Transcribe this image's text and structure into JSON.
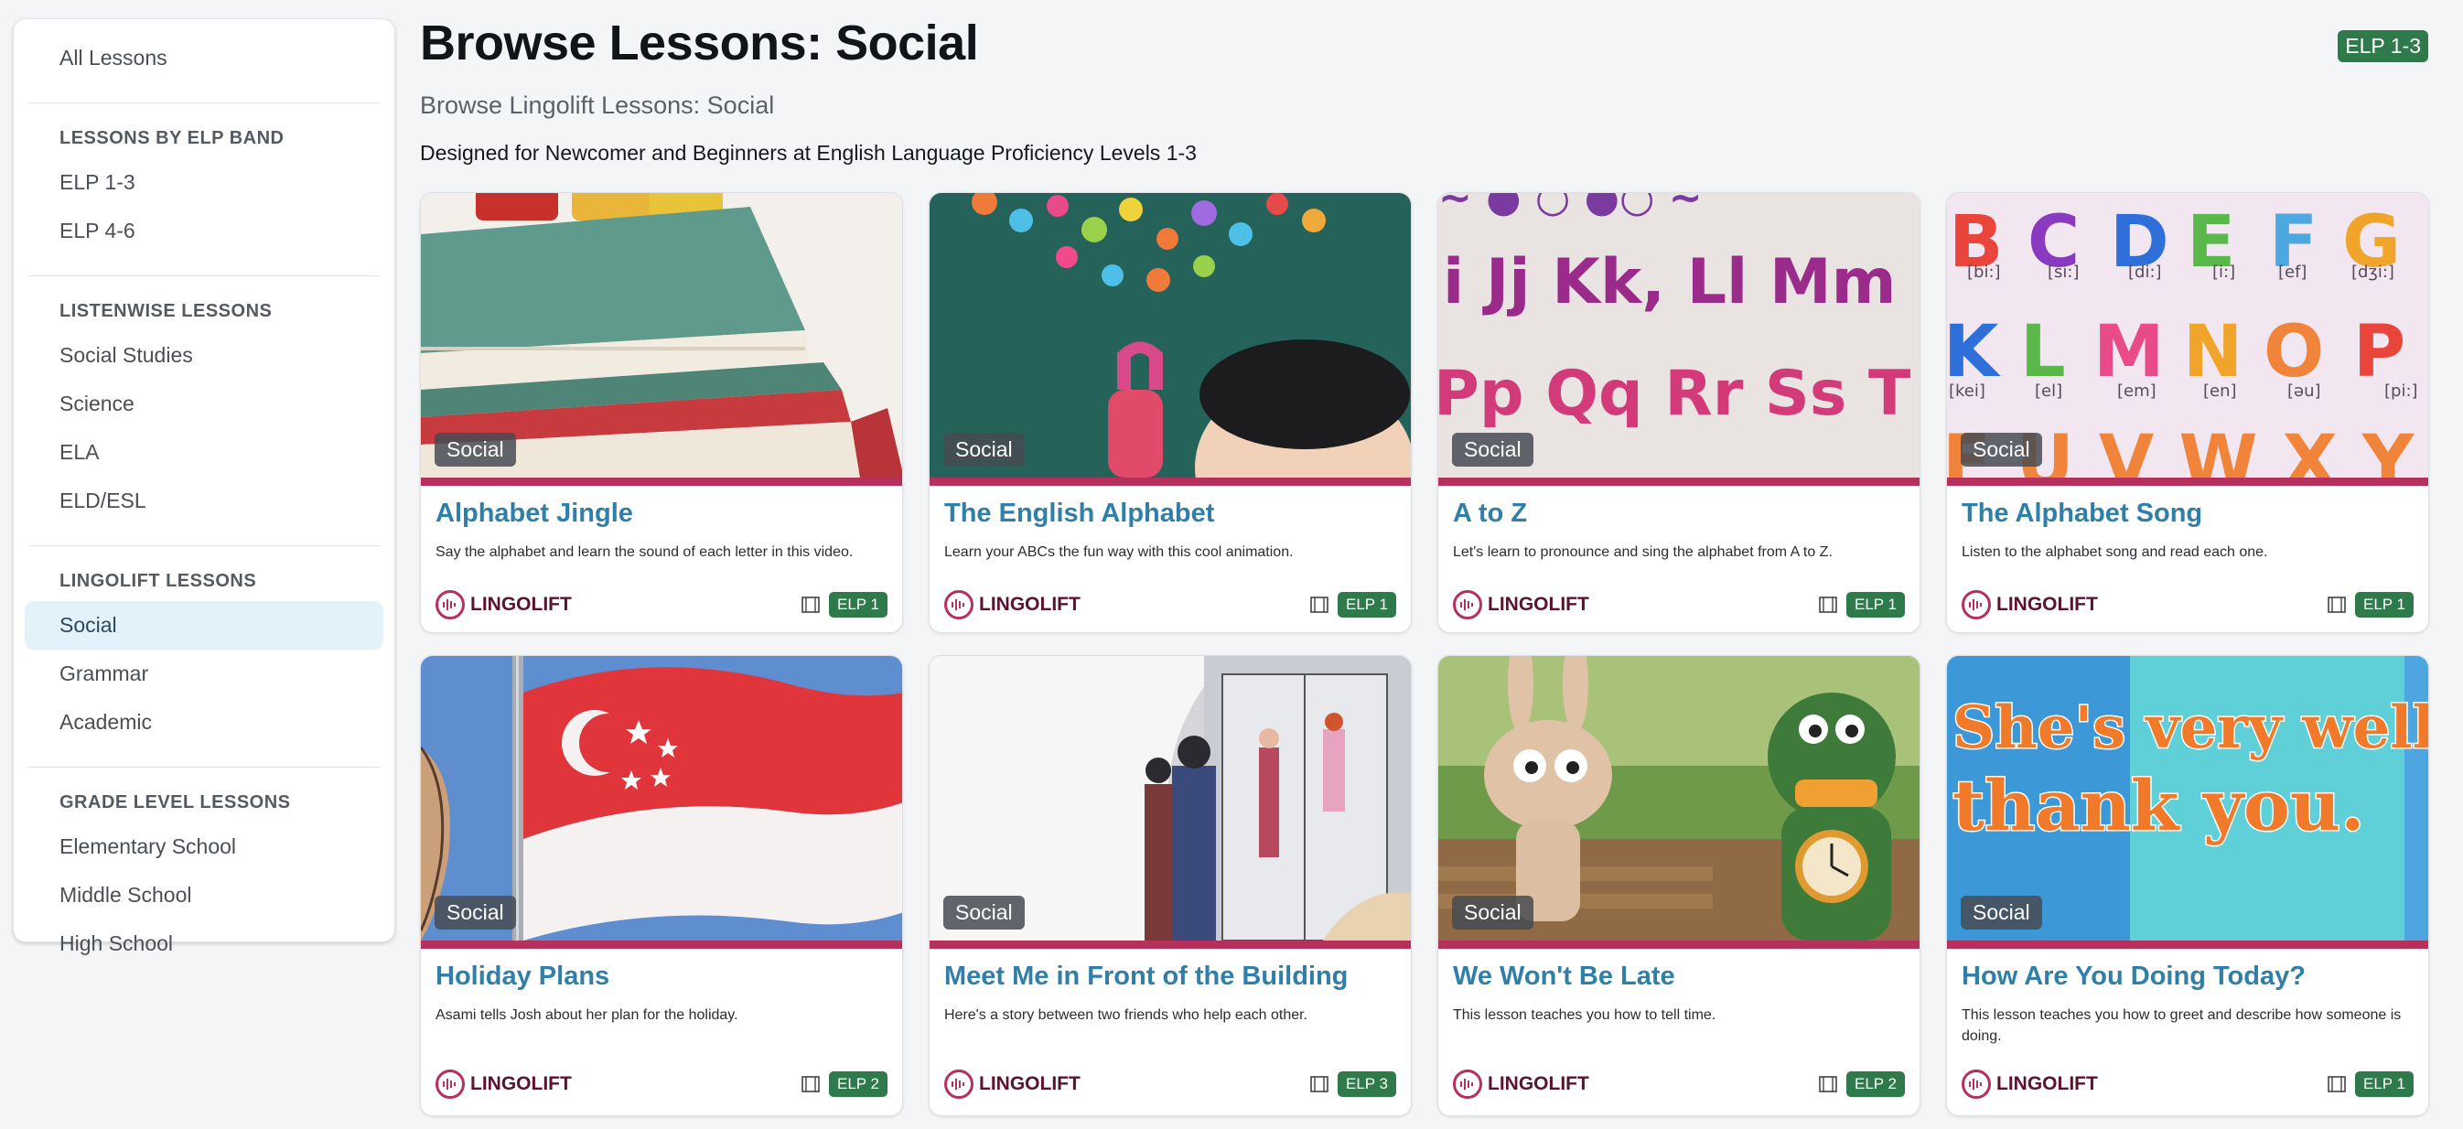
{
  "sidebar": {
    "all_lessons": "All Lessons",
    "sections": [
      {
        "heading": "LESSONS BY ELP BAND",
        "items": [
          "ELP 1-3",
          "ELP 4-6"
        ]
      },
      {
        "heading": "LISTENWISE LESSONS",
        "items": [
          "Social Studies",
          "Science",
          "ELA",
          "ELD/ESL"
        ]
      },
      {
        "heading": "LINGOLIFT LESSONS",
        "items": [
          "Social",
          "Grammar",
          "Academic"
        ]
      },
      {
        "heading": "GRADE LEVEL LESSONS",
        "items": [
          "Elementary School",
          "Middle School",
          "High School"
        ]
      }
    ],
    "active_item": "Social"
  },
  "header": {
    "title": "Browse Lessons: Social",
    "elp_badge": "ELP 1-3",
    "subtitle": "Browse Lingolift Lessons: Social",
    "description": "Designed for Newcomer and Beginners at English Language Proficiency Levels 1-3"
  },
  "cards": [
    {
      "tag": "Social",
      "title": "Alphabet Jingle",
      "desc": "Say the alphabet and learn the sound of each letter in this video.",
      "brand": "LINGOLIFT",
      "elp": "ELP 1",
      "icon": "books-thumbnail"
    },
    {
      "tag": "Social",
      "title": "The English Alphabet",
      "desc": "Learn your ABCs the fun way with this cool animation.",
      "brand": "LINGOLIFT",
      "elp": "ELP 1",
      "icon": "magnet-letters-thumbnail"
    },
    {
      "tag": "Social",
      "title": "A to Z",
      "desc": "Let's learn to pronounce and sing the alphabet from A to Z.",
      "brand": "LINGOLIFT",
      "elp": "ELP 1",
      "icon": "letters-thumbnail"
    },
    {
      "tag": "Social",
      "title": "The Alphabet Song",
      "desc": "Listen to the alphabet song and read each one.",
      "brand": "LINGOLIFT",
      "elp": "ELP 1",
      "icon": "alphabet-song-thumbnail"
    },
    {
      "tag": "Social",
      "title": "Holiday Plans",
      "desc": "Asami tells Josh about her plan for the holiday.",
      "brand": "LINGOLIFT",
      "elp": "ELP 2",
      "icon": "flag-thumbnail"
    },
    {
      "tag": "Social",
      "title": "Meet Me in Front of the Building",
      "desc": "Here's a story between two friends who help each other.",
      "brand": "LINGOLIFT",
      "elp": "ELP 3",
      "icon": "building-thumbnail"
    },
    {
      "tag": "Social",
      "title": "We Won't Be Late",
      "desc": "This lesson teaches you how to tell time.",
      "brand": "LINGOLIFT",
      "elp": "ELP 2",
      "icon": "puppets-thumbnail"
    },
    {
      "tag": "Social",
      "title": "How Are You Doing Today?",
      "desc": "This lesson teaches you how to greet and describe how someone is doing.",
      "brand": "LINGOLIFT",
      "elp": "ELP 1",
      "icon": "greeting-thumbnail"
    }
  ],
  "thumbnail_text": {
    "row_one": [
      "B",
      "C",
      "D",
      "E",
      "F",
      "G"
    ],
    "row_one_ipa": [
      "[bi:]",
      "[si:]",
      "[di:]",
      "[i:]",
      "[ef]",
      "[dʒi:]"
    ],
    "row_two": [
      "K",
      "L",
      "M",
      "N",
      "O",
      "P"
    ],
    "row_two_ipa": [
      "[kei]",
      "[el]",
      "[em]",
      "[en]",
      "[əu]",
      "[pi:]"
    ],
    "letters_row_one": "i Jj Kk, Ll Mm",
    "letters_row_two": "Pp Qq Rr Ss T",
    "greeting_line_one": "She's very well,",
    "greeting_line_two": "thank you."
  },
  "colors": {
    "accent_bar": "#b5305a",
    "title_blue": "#2f7fa8",
    "elp_green": "#2e7a4a",
    "active_bg": "#e3f1f8"
  }
}
